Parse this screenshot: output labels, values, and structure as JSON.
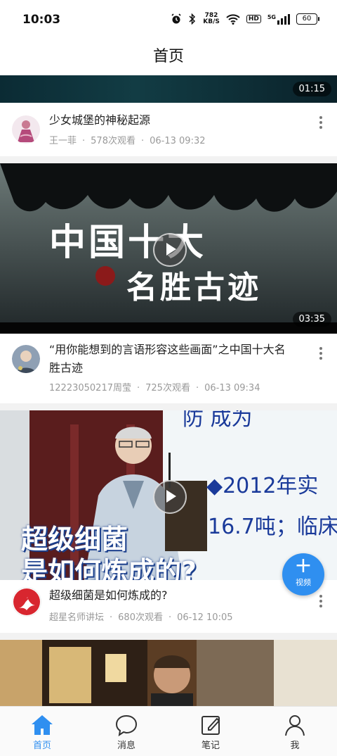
{
  "status_bar": {
    "time": "10:03",
    "net_speed_value": "782",
    "net_speed_unit": "KB/S",
    "hd": "HD",
    "network": "5G",
    "battery": "60"
  },
  "header": {
    "title": "首页"
  },
  "feed": [
    {
      "duration": "01:15",
      "title": "少女城堡的神秘起源",
      "author": "王一菲",
      "views": "578次观看",
      "time": "06-13 09:32"
    },
    {
      "duration": "03:35",
      "title": "“用你能想到的言语形容这些画面”之中国十大名胜古迹",
      "author": "12223050217周莹",
      "views": "725次观看",
      "time": "06-13 09:34"
    },
    {
      "duration": "",
      "title": "超级细菌是如何炼成的?",
      "author": "超星名师讲坛",
      "views": "680次观看",
      "time": "06-12 10:05"
    }
  ],
  "video_texts": {
    "v2_line1": "中国十大",
    "v2_line2": "名胜古迹",
    "v3_slide_a": "◆2012年实",
    "v3_slide_b": "16.7吨；临床",
    "v3_slide_top": "防 成为",
    "v3_caption1": "超级细菌",
    "v3_caption2": "是如何炼成的?"
  },
  "fab": {
    "label": "视频"
  },
  "tabbar": [
    {
      "label": "首页",
      "icon": "home-icon",
      "active": true
    },
    {
      "label": "消息",
      "icon": "message-icon",
      "active": false
    },
    {
      "label": "笔记",
      "icon": "note-icon",
      "active": false
    },
    {
      "label": "我",
      "icon": "user-icon",
      "active": false
    }
  ],
  "colors": {
    "accent": "#2f8ff0",
    "bg_divider": "#f2f2f2",
    "subtext": "#999999"
  }
}
